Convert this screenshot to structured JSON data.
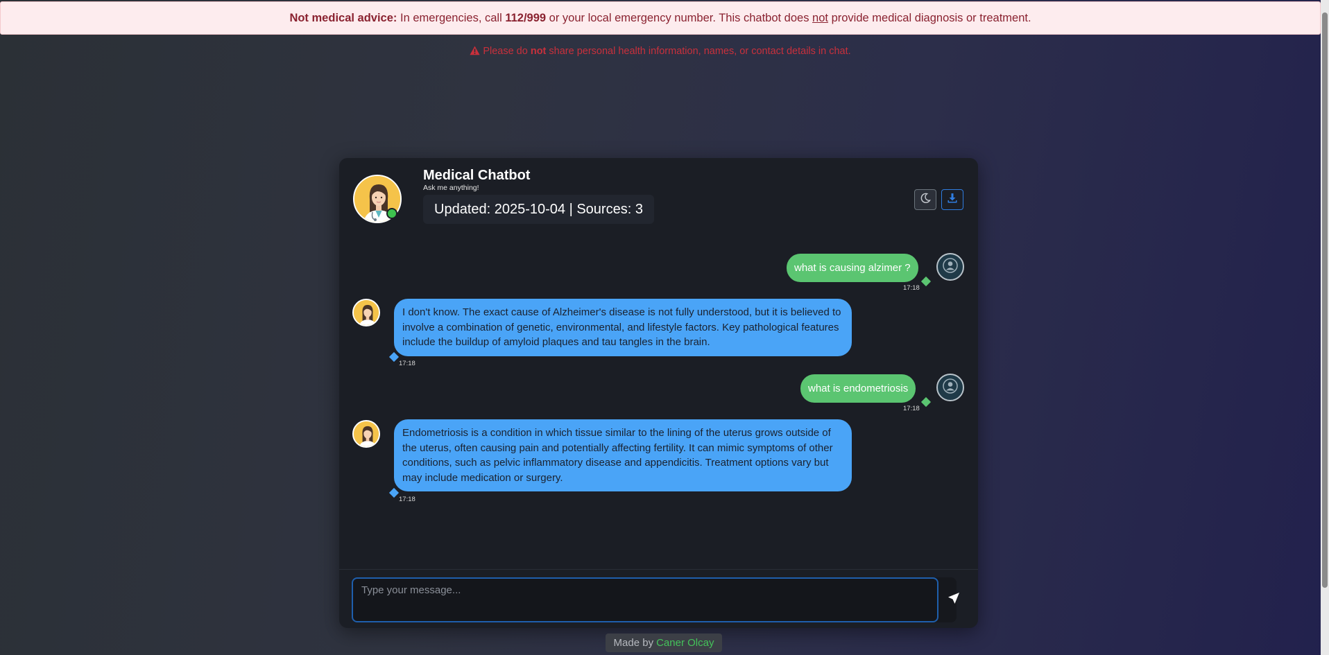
{
  "banner": {
    "label": "Not medical advice:",
    "text_1": " In emergencies, call ",
    "number": "112/999",
    "text_2": " or your local emergency number. This chatbot does ",
    "underlined": "not",
    "text_3": " provide medical diagnosis or treatment."
  },
  "privacy": {
    "icon": "warning-triangle-icon",
    "text_1": "Please do ",
    "bold": "not",
    "text_2": " share personal health information, names, or contact details in chat."
  },
  "header": {
    "title": "Medical Chatbot",
    "subtitle": "Ask me anything!",
    "status": "Updated: 2025-10-04 | Sources: 3",
    "theme_icon": "moon-icon",
    "download_icon": "download-icon",
    "online_color": "#3ec34f"
  },
  "messages": [
    {
      "role": "user",
      "text": "what is causing alzimer ?",
      "time": "17:18"
    },
    {
      "role": "bot",
      "text": "I don't know. The exact cause of Alzheimer's disease is not fully understood, but it is believed to involve a combination of genetic, environmental, and lifestyle factors. Key pathological features include the buildup of amyloid plaques and tau tangles in the brain.",
      "time": "17:18"
    },
    {
      "role": "user",
      "text": "what is endometriosis",
      "time": "17:18"
    },
    {
      "role": "bot",
      "text": "Endometriosis is a condition in which tissue similar to the lining of the uterus grows outside of the uterus, often causing pain and potentially affecting fertility. It can mimic symptoms of other conditions, such as pelvic inflammatory disease and appendicitis. Treatment options vary but may include medication or surgery.",
      "time": "17:18"
    }
  ],
  "composer": {
    "placeholder": "Type your message...",
    "send_icon": "send-icon"
  },
  "footer": {
    "prefix": "Made by",
    "author": "Caner Olcay"
  },
  "colors": {
    "user_bubble": "#5bc571",
    "bot_bubble": "#4aa4f7",
    "accent": "#2f7de1",
    "warning": "#c9303c"
  }
}
